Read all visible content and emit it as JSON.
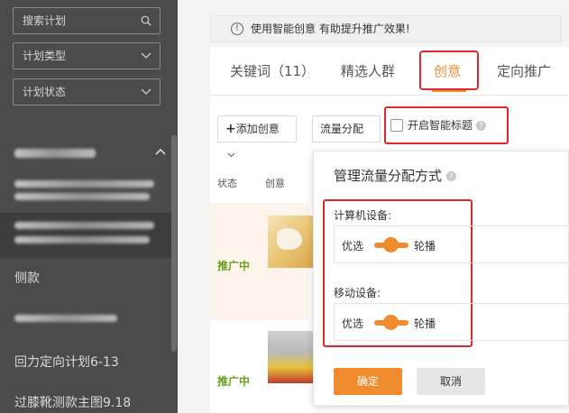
{
  "sidebar": {
    "search_placeholder": "搜索计划",
    "plan_type_label": "计划类型",
    "plan_status_label": "计划状态",
    "items": [
      {
        "label": "侧款"
      },
      {
        "label": "回力定向计划6-13"
      },
      {
        "label": "过膝靴测款主图9.18"
      }
    ]
  },
  "notice": {
    "text": "使用智能创意 有助提升推广效果!"
  },
  "tabs": [
    {
      "label": "关键词（11）"
    },
    {
      "label": "精选人群"
    },
    {
      "label": "创意"
    },
    {
      "label": "定向推广"
    }
  ],
  "toolbar": {
    "add_creative": "添加创意",
    "traffic_allocation": "流量分配",
    "smart_title": "开启智能标题"
  },
  "table": {
    "headers": [
      "状态",
      "创意"
    ],
    "rows": [
      {
        "status": "推广中"
      },
      {
        "status": "推广中"
      }
    ]
  },
  "popover": {
    "title": "管理流量分配方式",
    "computer_label": "计算机设备:",
    "mobile_label": "移动设备:",
    "opt_preferred": "优选",
    "opt_rotate": "轮播",
    "confirm": "确定",
    "cancel": "取消"
  },
  "colors": {
    "accent": "#f08c2e",
    "highlight_border": "#e0252b",
    "status_green": "#6a9e1f"
  }
}
